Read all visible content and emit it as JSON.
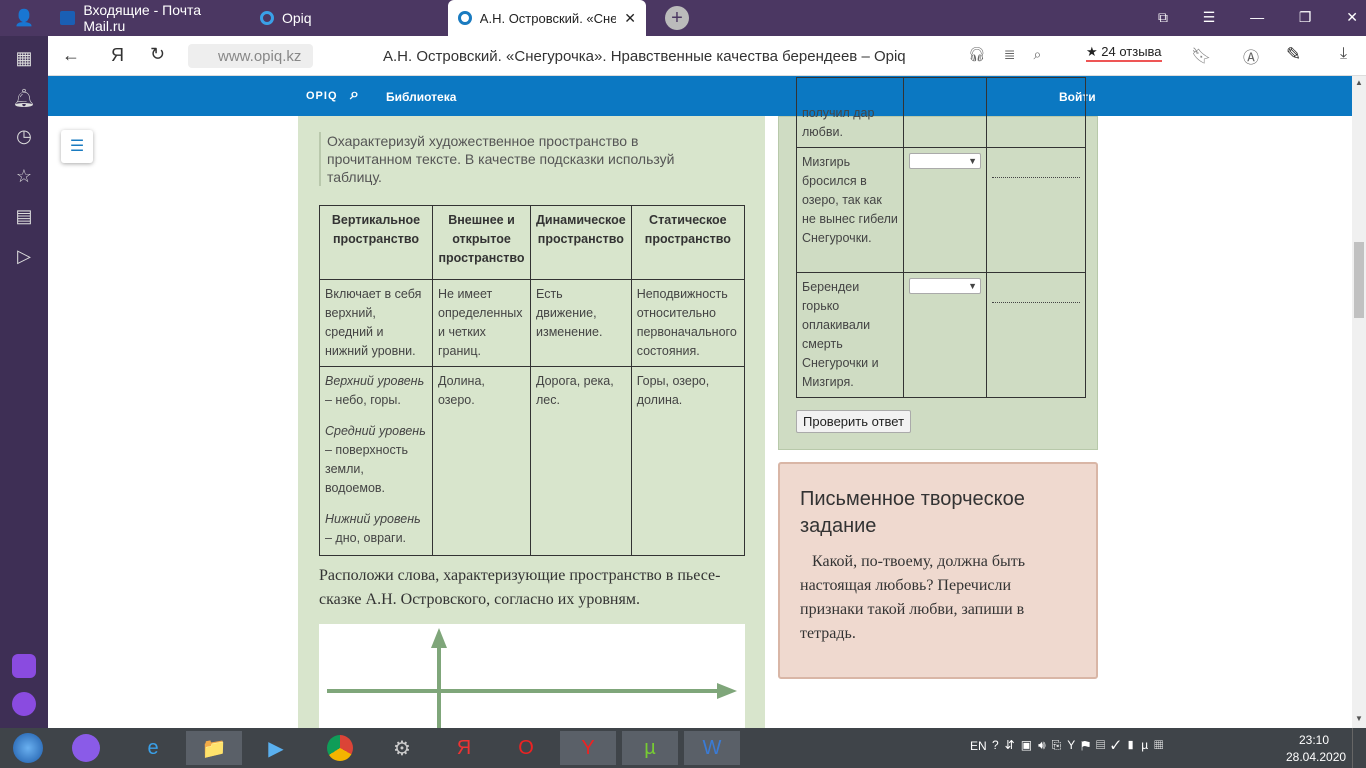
{
  "tabs": [
    {
      "label": "Входящие - Почта Mail.ru"
    },
    {
      "label": "Opiq"
    },
    {
      "label": "А.Н. Островский. «Снег"
    }
  ],
  "address": {
    "url": "www.opiq.kz",
    "page_title": "А.Н. Островский. «Снегурочка». Нравственные качества берендеев – Opiq",
    "reviews": "★ 24 отзыва"
  },
  "site": {
    "logo": "OPIQ",
    "library": "Библиотека",
    "login": "Войти"
  },
  "task": {
    "intro": "Охарактеризуй художественное пространство в прочитанном тексте. В качестве подсказки используй таблицу.",
    "headers": [
      "Вертикальное пространство",
      "Внешнее и открытое пространство",
      "Динамическое пространство",
      "Статическое пространство"
    ],
    "row1": [
      "Включает в себя верхний, средний и нижний уровни.",
      "Не имеет определенных и четких границ.",
      "Есть движение, изменение.",
      "Неподвижность относительно первоначального состояния."
    ],
    "row2_levels": [
      {
        "name": "Верхний уровень",
        "text": " – небо, горы."
      },
      {
        "name": "Средний уровень",
        "text": " – поверхность земли, водоемов."
      },
      {
        "name": "Нижний уровень",
        "text": " – дно, овраги."
      }
    ],
    "row2": [
      "Долина, озеро.",
      "Дорога, река, лес.",
      "Горы, озеро, долина."
    ],
    "arrange": "Расположи слова, характеризующие пространство в пьесе-сказке А.Н. Островского, согласно их уровням."
  },
  "quiz": {
    "rows": [
      "получил дар любви.",
      "Мизгирь бросился в озеро, так как не вынес гибели Снегурочки.",
      "Берендеи горько оплакивали смерть Снегурочки и Мизгиря."
    ],
    "check": "Проверить ответ"
  },
  "writing": {
    "title": "Письменное творческое задание",
    "text": "Какой, по-твоему, должна быть настоящая любовь? Перечисли признаки такой любви, запиши в тетрадь."
  },
  "tray": {
    "lang": "EN",
    "time": "23:10",
    "date": "28.04.2020"
  }
}
